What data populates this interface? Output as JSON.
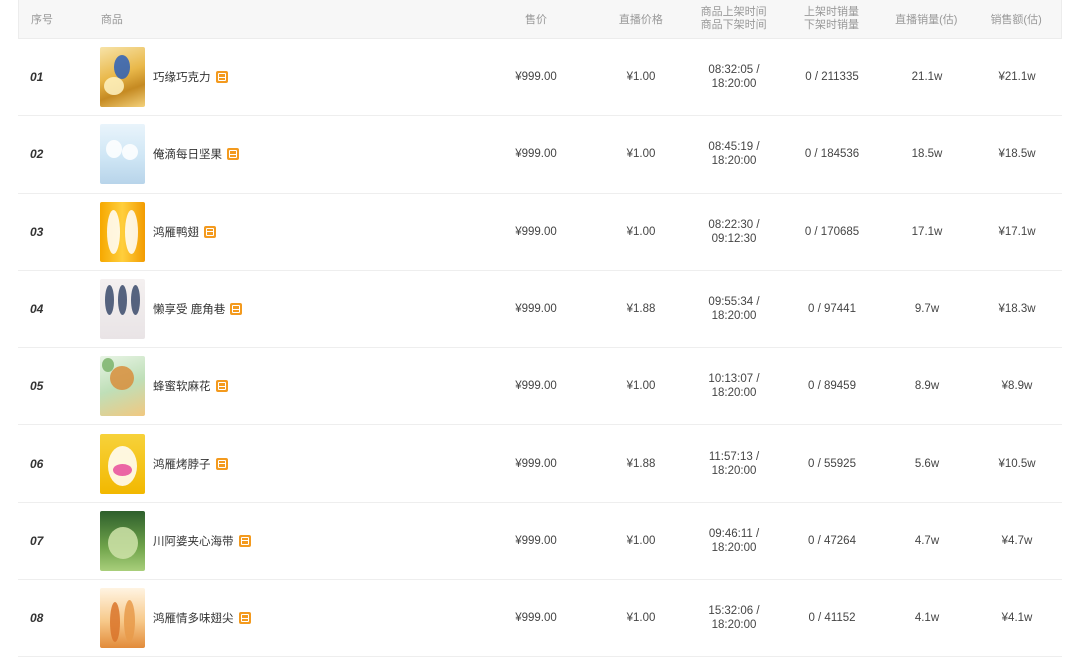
{
  "headers": {
    "index": "序号",
    "product": "商品",
    "price": "售价",
    "live_price": "直播价格",
    "time_line1": "商品上架时间",
    "time_line2": "商品下架时间",
    "stock_line1": "上架时销量",
    "stock_line2": "下架时销量",
    "live_volume": "直播销量(估)",
    "sales_amount": "销售额(估)"
  },
  "rows": [
    {
      "index": "01",
      "name": "巧缘巧克力",
      "price": "¥999.00",
      "live_price": "¥1.00",
      "time_up": "08:32:05 /",
      "time_down": "18:20:00",
      "stock": "0 / 211335",
      "volume": "21.1w",
      "amount": "¥21.1w"
    },
    {
      "index": "02",
      "name": "俺滴每日坚果",
      "price": "¥999.00",
      "live_price": "¥1.00",
      "time_up": "08:45:19 /",
      "time_down": "18:20:00",
      "stock": "0 / 184536",
      "volume": "18.5w",
      "amount": "¥18.5w"
    },
    {
      "index": "03",
      "name": "鸿雁鸭翅",
      "price": "¥999.00",
      "live_price": "¥1.00",
      "time_up": "08:22:30 /",
      "time_down": "09:12:30",
      "stock": "0 / 170685",
      "volume": "17.1w",
      "amount": "¥17.1w"
    },
    {
      "index": "04",
      "name": "懒享受 鹿角巷",
      "price": "¥999.00",
      "live_price": "¥1.88",
      "time_up": "09:55:34 /",
      "time_down": "18:20:00",
      "stock": "0 / 97441",
      "volume": "9.7w",
      "amount": "¥18.3w"
    },
    {
      "index": "05",
      "name": "蜂蜜软麻花",
      "price": "¥999.00",
      "live_price": "¥1.00",
      "time_up": "10:13:07 /",
      "time_down": "18:20:00",
      "stock": "0 / 89459",
      "volume": "8.9w",
      "amount": "¥8.9w"
    },
    {
      "index": "06",
      "name": "鸿雁烤脖子",
      "price": "¥999.00",
      "live_price": "¥1.88",
      "time_up": "11:57:13 /",
      "time_down": "18:20:00",
      "stock": "0 / 55925",
      "volume": "5.6w",
      "amount": "¥10.5w"
    },
    {
      "index": "07",
      "name": "川阿婆夹心海带",
      "price": "¥999.00",
      "live_price": "¥1.00",
      "time_up": "09:46:11 /",
      "time_down": "18:20:00",
      "stock": "0 / 47264",
      "volume": "4.7w",
      "amount": "¥4.7w"
    },
    {
      "index": "08",
      "name": "鸿雁情多味翅尖",
      "price": "¥999.00",
      "live_price": "¥1.00",
      "time_up": "15:32:06 /",
      "time_down": "18:20:00",
      "stock": "0 / 41152",
      "volume": "4.1w",
      "amount": "¥4.1w"
    }
  ],
  "icons": {
    "product_tag": "product-tag-icon",
    "thumbnail": "product-thumbnail"
  },
  "colors": {
    "tag": "#f39a1e",
    "header_bg": "#f7f7f7",
    "header_text": "#999999"
  }
}
